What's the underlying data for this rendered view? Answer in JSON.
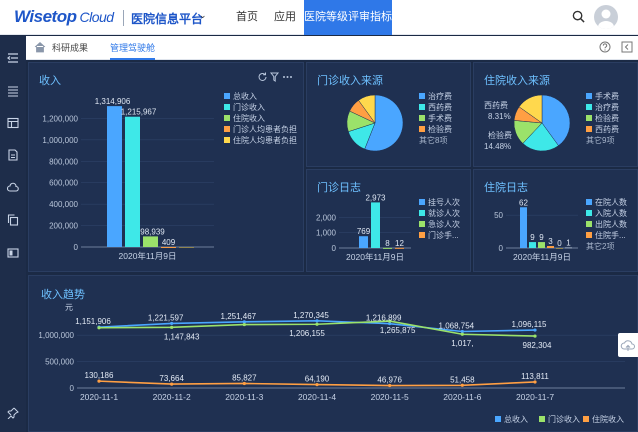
{
  "header": {
    "logo_main": "Wisetop",
    "logo_sub": "Cloud",
    "platform": "医院信息平台",
    "nav": [
      "首页",
      "应用",
      "医院等级评审指标"
    ]
  },
  "subnav": {
    "tabs": [
      "科研成果",
      "管理驾驶舱"
    ]
  },
  "icons": {
    "rail": [
      "menu-fold-icon",
      "list-icon",
      "table-icon",
      "document-icon",
      "cloud-icon",
      "copy-icon",
      "layout-icon",
      "pin-icon"
    ],
    "colors": {
      "accent": "#2f78e8",
      "blue": "#4aa6ff",
      "cyan": "#3ee8e8",
      "green": "#9be26a",
      "orange": "#ff9f43",
      "yellow": "#ffd84d"
    }
  },
  "income": {
    "title": "收入",
    "legend": [
      "总收入",
      "门诊收入",
      "住院收入",
      "门诊人均患者负担",
      "住院人均患者负担"
    ],
    "chart_data": {
      "type": "bar",
      "categories": [
        "2020年11月9日"
      ],
      "series": [
        {
          "name": "总收入",
          "values": [
            1314906
          ]
        },
        {
          "name": "门诊收入",
          "values": [
            1215967
          ]
        },
        {
          "name": "住院收入",
          "values": [
            98939
          ]
        },
        {
          "name": "门诊人均患者负担",
          "values": [
            409
          ]
        },
        {
          "name": "住院人均患者负担",
          "values": [
            0
          ]
        }
      ],
      "labels": [
        "1,314,906",
        "1,215,967",
        "98,939",
        "409"
      ],
      "yticks": [
        "0",
        "200,000",
        "400,000",
        "600,000",
        "800,000",
        "1,000,000",
        "1,200,000"
      ],
      "ylim": [
        0,
        1400000
      ]
    }
  },
  "outpatient_source": {
    "title": "门诊收入来源",
    "legend": [
      "治疗费",
      "西药费",
      "手术费",
      "检验费",
      "其它8项"
    ],
    "chart_data": {
      "type": "pie",
      "categories": [
        "治疗费",
        "西药费",
        "手术费",
        "检验费",
        "其它"
      ],
      "values": [
        56,
        14,
        12,
        8,
        10
      ]
    }
  },
  "inpatient_source": {
    "title": "住院收入来源",
    "legend": [
      "手术费",
      "治疗费",
      "检验费",
      "西药费",
      "其它9项"
    ],
    "labels": [
      "西药费",
      "8.31%",
      "检验费",
      "14.48%"
    ],
    "chart_data": {
      "type": "pie",
      "categories": [
        "手术费",
        "治疗费",
        "检验费",
        "西药费",
        "其它"
      ],
      "values": [
        40,
        22,
        14.48,
        8.31,
        15.21
      ]
    }
  },
  "outpatient_log": {
    "title": "门诊日志",
    "legend": [
      "挂号人次",
      "就诊人次",
      "急诊人次",
      "门诊手..."
    ],
    "chart_data": {
      "type": "bar",
      "categories": [
        "2020年11月9日"
      ],
      "series": [
        {
          "name": "挂号人次",
          "values": [
            769
          ]
        },
        {
          "name": "就诊人次",
          "values": [
            2973
          ]
        },
        {
          "name": "急诊人次",
          "values": [
            8
          ]
        },
        {
          "name": "门诊手...",
          "values": [
            12
          ]
        }
      ],
      "labels": [
        "769",
        "2,973",
        "8",
        "12"
      ],
      "yticks": [
        "0",
        "1,000",
        "2,000"
      ],
      "ylim": [
        0,
        3000
      ]
    }
  },
  "inpatient_log": {
    "title": "住院日志",
    "legend": [
      "在院人数",
      "入院人数",
      "出院人数",
      "住院手...",
      "其它2项"
    ],
    "chart_data": {
      "type": "bar",
      "categories": [
        "2020年11月9日"
      ],
      "series": [
        {
          "name": "在院人数",
          "values": [
            62
          ]
        },
        {
          "name": "入院人数",
          "values": [
            9
          ]
        },
        {
          "name": "出院人数",
          "values": [
            9
          ]
        },
        {
          "name": "住院手...",
          "values": [
            3
          ]
        },
        {
          "name": "",
          "values": [
            0
          ]
        },
        {
          "name": "",
          "values": [
            1
          ]
        }
      ],
      "labels": [
        "62",
        "9",
        "9",
        "3",
        "0",
        "1"
      ],
      "yticks": [
        "0",
        "50"
      ],
      "ylim": [
        0,
        70
      ]
    }
  },
  "trend": {
    "title": "收入趋势",
    "unit": "元",
    "legend": [
      "总收入",
      "门诊收入",
      "住院收入"
    ],
    "chart_data": {
      "type": "line",
      "x": [
        "2020-11-1",
        "2020-11-2",
        "2020-11-3",
        "2020-11-4",
        "2020-11-5",
        "2020-11-6",
        "2020-11-7"
      ],
      "series": [
        {
          "name": "总收入",
          "values": [
            1151906,
            1221597,
            1251467,
            1270345,
            1216899,
            1068754,
            1096115
          ]
        },
        {
          "name": "门诊收入",
          "values": [
            1140000,
            1147843,
            1200000,
            1206155,
            1265875,
            1017000,
            982304
          ]
        },
        {
          "name": "住院收入",
          "values": [
            130186,
            73664,
            85827,
            64190,
            46976,
            51458,
            113811
          ]
        }
      ],
      "labels_total": [
        "1,151,906",
        "1,221,597",
        "1,251,467",
        "1,270,345",
        "1,216,899",
        "1,068,754",
        "1,096,115"
      ],
      "labels_outpatient": [
        "1,147,843",
        "1,206,155",
        "1,265,875",
        "1,017,",
        "982,304"
      ],
      "labels_inpatient": [
        "130,186",
        "73,664",
        "85,827",
        "64,190",
        "46,976",
        "51,458",
        "113,811"
      ],
      "yticks": [
        "0",
        "500,000",
        "1,000,000"
      ],
      "ylim": [
        0,
        1400000
      ]
    }
  }
}
